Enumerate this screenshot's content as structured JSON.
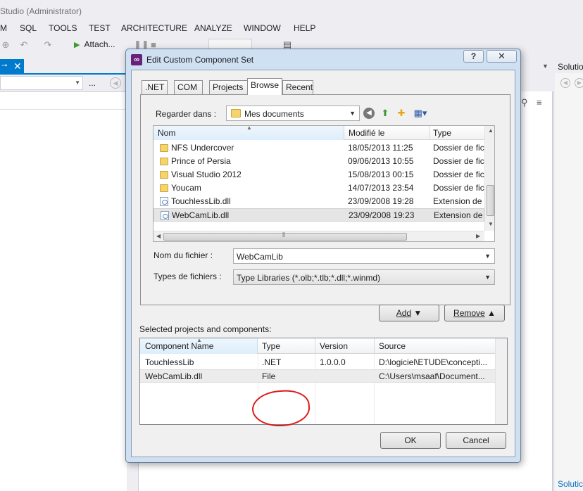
{
  "ide": {
    "title": "Studio (Administrator)",
    "menu": [
      "M",
      "SQL",
      "TOOLS",
      "TEST",
      "ARCHITECTURE",
      "ANALYZE",
      "WINDOW",
      "HELP"
    ],
    "toolbar": {
      "attach_label": "Attach..."
    },
    "left_panel": {
      "dots": "..."
    },
    "right_panel": {
      "title": "Solutio",
      "bottom_tab": "Solutic"
    }
  },
  "dialog": {
    "title": "Edit Custom Component Set",
    "help_label": "?",
    "close_label": "✕",
    "tabs": [
      {
        "label": ".NET"
      },
      {
        "label": "COM"
      },
      {
        "label": "Projects"
      },
      {
        "label": "Browse",
        "active": true
      },
      {
        "label": "Recent"
      }
    ],
    "browse": {
      "look_in_label": "Regarder dans :",
      "look_in_value": "Mes documents",
      "columns": [
        "Nom",
        "Modifié le",
        "Type"
      ],
      "files": [
        {
          "name": "NFS Undercover",
          "modified": "18/05/2013 11:25",
          "type": "Dossier de fichiers",
          "icon": "folder-icon"
        },
        {
          "name": "Prince of Persia",
          "modified": "09/06/2013 10:55",
          "type": "Dossier de fichiers",
          "icon": "folder-icon"
        },
        {
          "name": "Visual Studio 2012",
          "modified": "15/08/2013 00:15",
          "type": "Dossier de fichiers",
          "icon": "folder-icon"
        },
        {
          "name": "Youcam",
          "modified": "14/07/2013 23:54",
          "type": "Dossier de fichiers",
          "icon": "folder-icon"
        },
        {
          "name": "TouchlessLib.dll",
          "modified": "23/09/2008 19:28",
          "type": "Extension de l'application",
          "icon": "dll-icon"
        },
        {
          "name": "WebCamLib.dll",
          "modified": "23/09/2008 19:23",
          "type": "Extension de l'application",
          "icon": "dll-icon",
          "selected": true
        }
      ],
      "filename_label": "Nom du fichier :",
      "filename_value": "WebCamLib",
      "filetype_label": "Types de fichiers :",
      "filetype_value": "Type Libraries (*.olb;*.tlb;*.dll;*.winmd)"
    },
    "add_label": "Add",
    "remove_label": "Remove",
    "selected_label": "Selected projects and components:",
    "components": {
      "columns": [
        "Component Name",
        "Type",
        "Version",
        "Source"
      ],
      "rows": [
        {
          "name": "TouchlessLib",
          "type": ".NET",
          "version": "1.0.0.0",
          "source": "D:\\logiciel\\ETUDE\\concepti..."
        },
        {
          "name": "WebCamLib.dll",
          "type": "File",
          "version": "",
          "source": "C:\\Users\\msaaf\\Document...",
          "selected": true
        }
      ]
    },
    "ok_label": "OK",
    "cancel_label": "Cancel"
  }
}
